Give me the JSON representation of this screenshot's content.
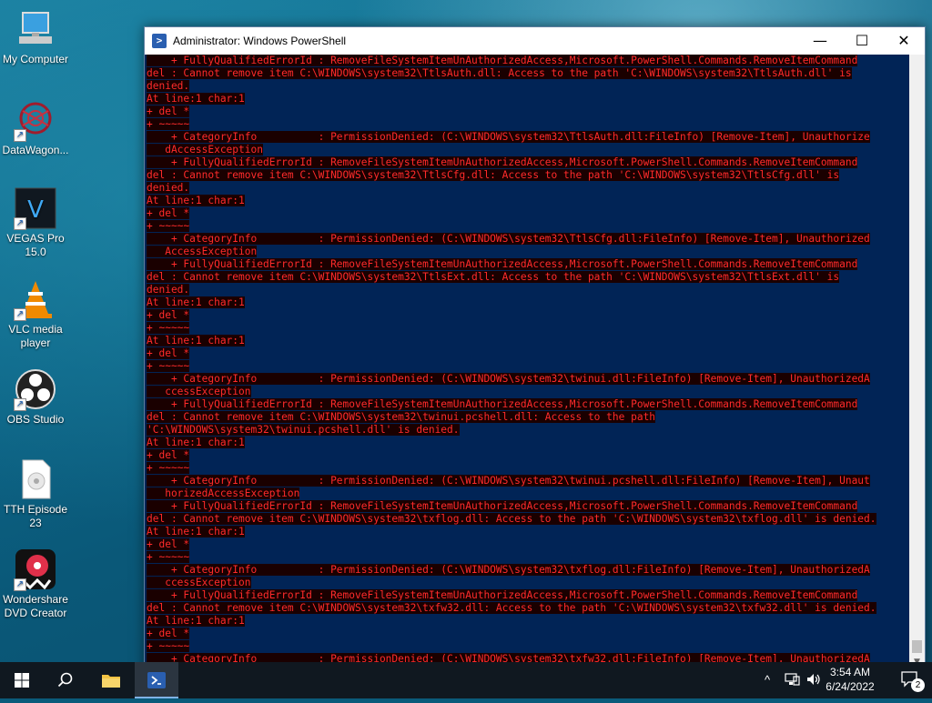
{
  "desktop": {
    "icons": [
      {
        "label": "My Computer",
        "icon": "computer-icon"
      },
      {
        "label": "DataWagon...",
        "icon": "datawagon-icon"
      },
      {
        "label": "VEGAS Pro 15.0",
        "icon": "vegas-pro-icon"
      },
      {
        "label": "VLC media player",
        "icon": "vlc-icon"
      },
      {
        "label": "OBS Studio",
        "icon": "obs-icon"
      },
      {
        "label": "TTH Episode 23",
        "icon": "video-file-icon"
      },
      {
        "label": "Wondershare DVD Creator",
        "icon": "dvd-creator-icon"
      }
    ]
  },
  "window": {
    "title": "Administrator: Windows PowerShell",
    "minimize": "—",
    "maximize": "☐",
    "close": "✕",
    "bg_color": "#012456",
    "text_color": "#ff2b2b"
  },
  "console": {
    "lines": [
      "    + FullyQualifiedErrorId : RemoveFileSystemItemUnAuthorizedAccess,Microsoft.PowerShell.Commands.RemoveItemCommand",
      "del : Cannot remove item C:\\WINDOWS\\system32\\TtlsAuth.dll: Access to the path 'C:\\WINDOWS\\system32\\TtlsAuth.dll' is",
      "denied.",
      "At line:1 char:1",
      "+ del *",
      "+ ~~~~~",
      "    + CategoryInfo          : PermissionDenied: (C:\\WINDOWS\\system32\\TtlsAuth.dll:FileInfo) [Remove-Item], Unauthorize",
      "   dAccessException",
      "    + FullyQualifiedErrorId : RemoveFileSystemItemUnAuthorizedAccess,Microsoft.PowerShell.Commands.RemoveItemCommand",
      "del : Cannot remove item C:\\WINDOWS\\system32\\TtlsCfg.dll: Access to the path 'C:\\WINDOWS\\system32\\TtlsCfg.dll' is",
      "denied.",
      "At line:1 char:1",
      "+ del *",
      "+ ~~~~~",
      "    + CategoryInfo          : PermissionDenied: (C:\\WINDOWS\\system32\\TtlsCfg.dll:FileInfo) [Remove-Item], Unauthorized",
      "   AccessException",
      "    + FullyQualifiedErrorId : RemoveFileSystemItemUnAuthorizedAccess,Microsoft.PowerShell.Commands.RemoveItemCommand",
      "del : Cannot remove item C:\\WINDOWS\\system32\\TtlsExt.dll: Access to the path 'C:\\WINDOWS\\system32\\TtlsExt.dll' is",
      "denied.",
      "At line:1 char:1",
      "+ del *",
      "+ ~~~~~",
      "At line:1 char:1",
      "+ del *",
      "+ ~~~~~",
      "    + CategoryInfo          : PermissionDenied: (C:\\WINDOWS\\system32\\twinui.dll:FileInfo) [Remove-Item], UnauthorizedA",
      "   ccessException",
      "    + FullyQualifiedErrorId : RemoveFileSystemItemUnAuthorizedAccess,Microsoft.PowerShell.Commands.RemoveItemCommand",
      "del : Cannot remove item C:\\WINDOWS\\system32\\twinui.pcshell.dll: Access to the path",
      "'C:\\WINDOWS\\system32\\twinui.pcshell.dll' is denied.",
      "At line:1 char:1",
      "+ del *",
      "+ ~~~~~",
      "    + CategoryInfo          : PermissionDenied: (C:\\WINDOWS\\system32\\twinui.pcshell.dll:FileInfo) [Remove-Item], Unaut",
      "   horizedAccessException",
      "    + FullyQualifiedErrorId : RemoveFileSystemItemUnAuthorizedAccess,Microsoft.PowerShell.Commands.RemoveItemCommand",
      "del : Cannot remove item C:\\WINDOWS\\system32\\txflog.dll: Access to the path 'C:\\WINDOWS\\system32\\txflog.dll' is denied.",
      "At line:1 char:1",
      "+ del *",
      "+ ~~~~~",
      "    + CategoryInfo          : PermissionDenied: (C:\\WINDOWS\\system32\\txflog.dll:FileInfo) [Remove-Item], UnauthorizedA",
      "   ccessException",
      "    + FullyQualifiedErrorId : RemoveFileSystemItemUnAuthorizedAccess,Microsoft.PowerShell.Commands.RemoveItemCommand",
      "del : Cannot remove item C:\\WINDOWS\\system32\\txfw32.dll: Access to the path 'C:\\WINDOWS\\system32\\txfw32.dll' is denied.",
      "At line:1 char:1",
      "+ del *",
      "+ ~~~~~",
      "    + CategoryInfo          : PermissionDenied: (C:\\WINDOWS\\system32\\txfw32.dll:FileInfo) [Remove-Item], UnauthorizedA"
    ]
  },
  "taskbar": {
    "start_icon": "windows-start-icon",
    "search_icon": "search-icon",
    "file_explorer_icon": "folder-icon",
    "powershell_icon": "powershell-icon",
    "tray": {
      "chevron": "^",
      "time": "3:54 AM",
      "date": "6/24/2022",
      "notification_count": "2"
    }
  }
}
